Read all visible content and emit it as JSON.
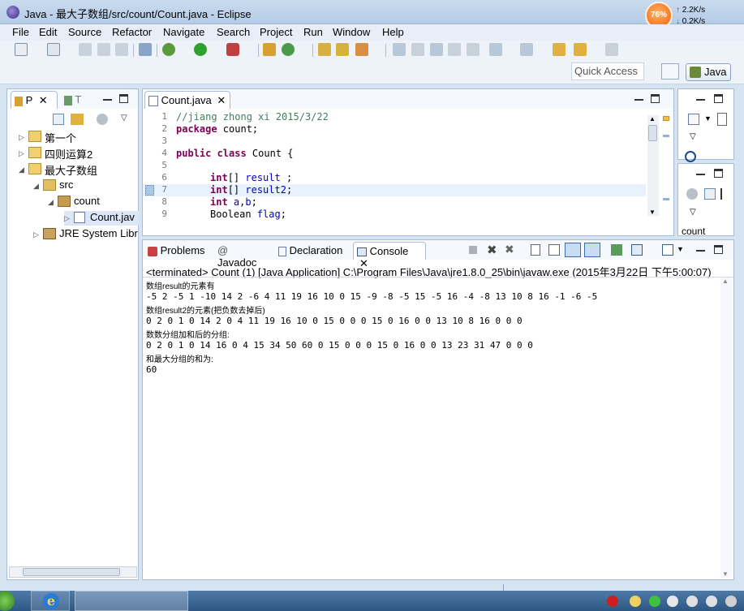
{
  "window": {
    "title": "Java - 最大子数组/src/count/Count.java - Eclipse",
    "net_percent": "76%",
    "net_up": "2.2K/s",
    "net_down": "0.2K/s"
  },
  "menu": [
    "File",
    "Edit",
    "Source",
    "Refactor",
    "Navigate",
    "Search",
    "Project",
    "Run",
    "Window",
    "Help"
  ],
  "toolbar": {
    "quick_access": "Quick Access",
    "perspective": "Java"
  },
  "package_explorer": {
    "tab_p": "P",
    "tab_t": "T",
    "items": [
      {
        "label": "第一个",
        "twisty": "▷"
      },
      {
        "label": "四则运算2",
        "twisty": "▷"
      },
      {
        "label": "最大子数组",
        "twisty": "◢"
      },
      {
        "label": "src",
        "twisty": "◢"
      },
      {
        "label": "count",
        "twisty": "◢"
      },
      {
        "label": "Count.jav",
        "twisty": "▷"
      },
      {
        "label": "JRE System Libr",
        "twisty": "▷"
      }
    ]
  },
  "editor": {
    "tab": "Count.java",
    "lines": [
      {
        "n": "1",
        "t": "//jiang zhong xi 2015/3/22"
      },
      {
        "n": "2",
        "t": "package count;"
      },
      {
        "n": "3",
        "t": ""
      },
      {
        "n": "4",
        "t": "public class Count {"
      },
      {
        "n": "5",
        "t": ""
      },
      {
        "n": "6",
        "t": "int[] result ;"
      },
      {
        "n": "7",
        "t": "int[] result2;"
      },
      {
        "n": "8",
        "t": "int a,b;"
      },
      {
        "n": "9",
        "t": "Boolean flag;"
      }
    ]
  },
  "right_panel": {
    "outline_label": "count"
  },
  "console_panel": {
    "tabs": [
      "Problems",
      "Javadoc",
      "Declaration",
      "Console"
    ],
    "info": "<terminated> Count (1) [Java Application] C:\\Program Files\\Java\\jre1.8.0_25\\bin\\javaw.exe (2015年3月22日 下午5:00:07)",
    "output": [
      {
        "t": "数组result的元素有",
        "small": true
      },
      {
        "t": "-5 2 -5 1 -10 14 2 -6 4 11 19 16 10 0 15 -9 -8 -5 15 -5 16 -4 -8 13 10 8 16 -1 -6 -5",
        "small": false
      },
      {
        "t": "数组result2的元素(把负数去掉后)",
        "small": true
      },
      {
        "t": "0 2 0 1 0 14 2 0 4 11 19 16 10 0 15 0 0 0 15 0 16 0 0 13 10 8 16 0 0 0",
        "small": false
      },
      {
        "t": "数数分组加和后的分组:",
        "small": true
      },
      {
        "t": "0 2 0 1 0 14 16 0 4 15 34 50 60 0 15 0 0 0 15 0 16 0 0 13 23 31 47 0 0 0",
        "small": false
      },
      {
        "t": "和最大分组的和为:",
        "small": true
      },
      {
        "t": "60",
        "small": false
      }
    ]
  }
}
